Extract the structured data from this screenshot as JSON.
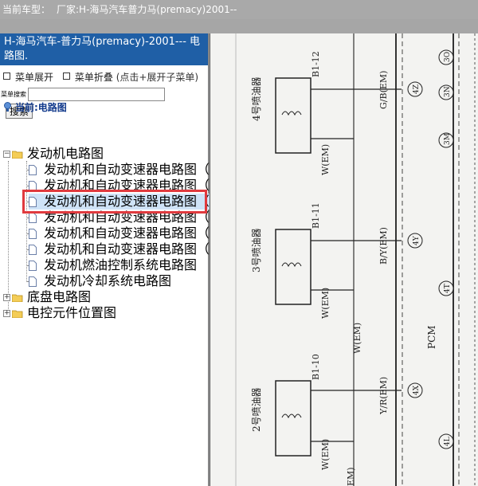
{
  "topbar": {
    "prefix": "当前车型：",
    "text": "厂家:H-海马汽车普力马(premacy)2001--"
  },
  "sidebar": {
    "title": "H-海马汽车-普力马(premacy)-2001--- 电路图.",
    "expand_label": "菜单展开",
    "collapse_label": "菜单折叠",
    "hint": "(点击+展开子菜单)",
    "search_label": "菜单搜索",
    "search_value": "",
    "search_button": "搜索",
    "current_label": "当前:电路图"
  },
  "tree": {
    "engine": {
      "label": "发动机电路图",
      "children": [
        "发动机和自动变速器电路图（一）",
        "发动机和自动变速器电路图（二）",
        "发动机和自动变速器电路图（三）",
        "发动机和自动变速器电路图（四）",
        "发动机和自动变速器电路图（五）",
        "发动机和自动变速器电路图（六）",
        "发动机燃油控制系统电路图",
        "发动机冷却系统电路图"
      ]
    },
    "chassis": {
      "label": "底盘电路图"
    },
    "electronic": {
      "label": "电控元件位置图"
    },
    "selected_index": 2
  },
  "diagram": {
    "injectors": [
      {
        "name": "4号喷油器",
        "connector": "B1-12",
        "wire_top": "G/B(EM)",
        "wire_bottom": "W(EM)",
        "pin": "4Z"
      },
      {
        "name": "3号喷油器",
        "connector": "B1-11",
        "wire_top": "B/Y(EM)",
        "wire_bottom": "W(EM)",
        "pin": "4Y"
      },
      {
        "name": "2号喷油器",
        "connector": "B1-10",
        "wire_top": "Y/R(EM)",
        "wire_bottom": "W(EM)",
        "pin": "4X"
      }
    ],
    "right_pins": [
      "3O",
      "3N",
      "3M",
      "4T",
      "4L"
    ],
    "side_wires": [
      "W(EM)",
      "W(EM)",
      "EM)"
    ],
    "module": "PCM"
  }
}
